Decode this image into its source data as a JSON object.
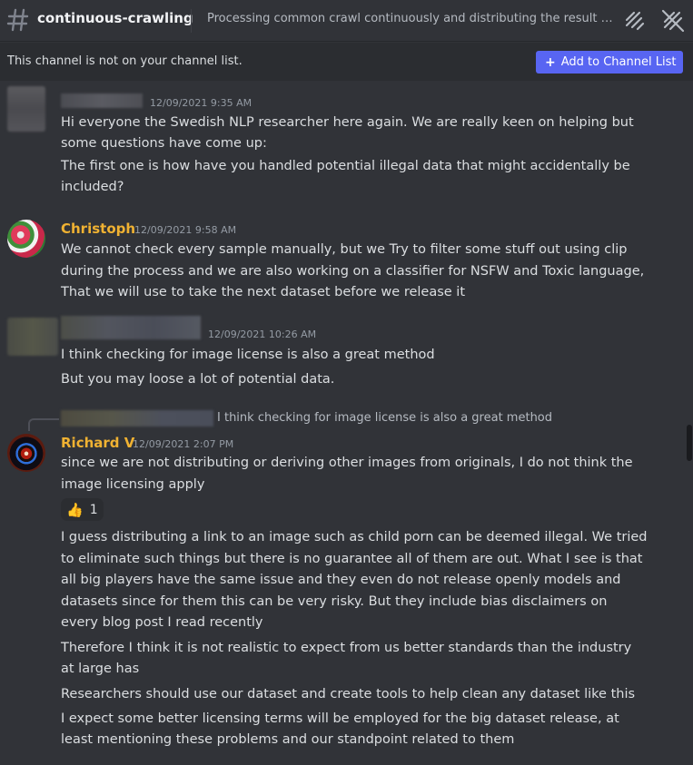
{
  "header": {
    "channel_name": "continuous-crawling",
    "topic": "Processing common crawl continuously and distributing the result co...",
    "icons": [
      "hash-icon",
      "threads-icon",
      "notifications-muted-icon"
    ]
  },
  "notice": {
    "text": "This channel is not on your channel list.",
    "button_label": "Add to Channel List",
    "accent": "#5865f2"
  },
  "messages": [
    {
      "author": "",
      "timestamp": "12/09/2021 9:35 AM",
      "lines": [
        "Hi everyone the Swedish NLP researcher here again. We are really keen on helping but",
        "some questions have come up:",
        "The first one is how have you handled potential illegal data that might accidentally be",
        "included?"
      ]
    },
    {
      "author": "Christoph",
      "timestamp": "12/09/2021 9:58 AM",
      "lines": [
        "We cannot check every sample manually, but we Try to filter some stuff out using clip",
        "during the process and we are also working on a classifier for NSFW and Toxic language,",
        "That we will use to take the next dataset before we release it"
      ]
    },
    {
      "author": "",
      "timestamp": "12/09/2021 10:26 AM",
      "lines": [
        "I think checking for image license is also a great method",
        "But you may loose a lot of potential data."
      ]
    },
    {
      "author": "Richard V",
      "timestamp": "12/09/2021 2:07 PM",
      "reply_to": "I think checking for image license is also a great method",
      "lines": [
        "since we are not distributing or deriving other images from originals, I do not think the",
        "image licensing apply"
      ],
      "reaction": {
        "emoji": "👍",
        "count": "1"
      },
      "followups": [
        "I guess distributing a link to an image such as child porn can be deemed illegal. We tried",
        "to eliminate such things but there is no guarantee all of them are out. What I see is that",
        "all big players have the same issue and they even do not release openly models and",
        "datasets since for them this can be very risky. But they include bias disclaimers on",
        "every blog post I read recently",
        "Therefore I think it is not realistic to expect from us better standards than the industry",
        "at large has",
        "Researchers should use our dataset and create tools to help clean any dataset like this",
        "I expect some better licensing terms will be employed for the big dataset release, at",
        "least mentioning these problems and our standpoint related to them"
      ]
    }
  ],
  "colors": {
    "background": "#313338",
    "author_name": "#f0b232",
    "timestamp": "#949ba4",
    "text": "#dbdee1"
  }
}
